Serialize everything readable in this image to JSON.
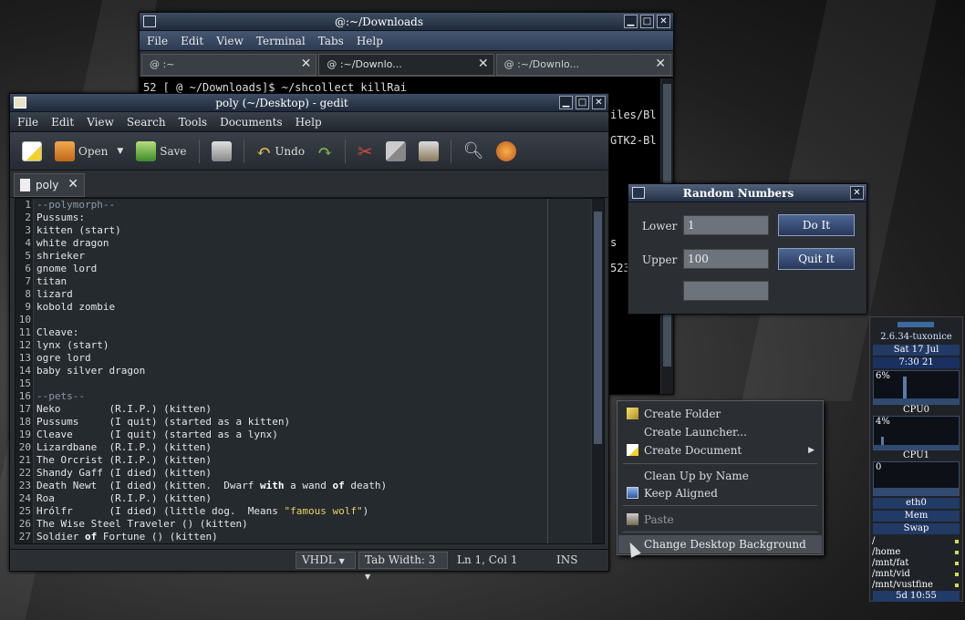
{
  "terminal": {
    "title": "@:~/Downloads",
    "menu": [
      "File",
      "Edit",
      "View",
      "Terminal",
      "Tabs",
      "Help"
    ],
    "tabs": [
      "@ :~",
      "@ :~/Downlo...",
      "@ :~/Downlo..."
    ],
    "prompt_line": "52 [ @ ~/Downloads]$ ~/shcollect killRai",
    "fragments": [
      "iles/Bl",
      "GTK2-Bl",
      "s",
      "523"
    ]
  },
  "gedit": {
    "title": "poly (~/Desktop) - gedit",
    "menu": [
      "File",
      "Edit",
      "View",
      "Search",
      "Tools",
      "Documents",
      "Help"
    ],
    "toolbar": {
      "open_label": "Open",
      "save_label": "Save",
      "undo_label": "Undo"
    },
    "tab_label": "poly",
    "lines": [
      {
        "n": "1",
        "text": "--polymorph--",
        "cls": "comment"
      },
      {
        "n": "2",
        "text": "Pussums:"
      },
      {
        "n": "3",
        "text": "kitten (start)"
      },
      {
        "n": "4",
        "text": "white dragon"
      },
      {
        "n": "5",
        "text": "shrieker"
      },
      {
        "n": "6",
        "text": "gnome lord"
      },
      {
        "n": "7",
        "text": "titan"
      },
      {
        "n": "8",
        "text": "lizard"
      },
      {
        "n": "9",
        "text": "kobold zombie"
      },
      {
        "n": "10",
        "text": ""
      },
      {
        "n": "11",
        "text": "Cleave:"
      },
      {
        "n": "12",
        "text": "lynx (start)"
      },
      {
        "n": "13",
        "text": "ogre lord"
      },
      {
        "n": "14",
        "text": "baby silver dragon"
      },
      {
        "n": "15",
        "text": ""
      },
      {
        "n": "16",
        "text": "--pets--",
        "cls": "comment"
      },
      {
        "n": "17",
        "text": "Neko        (R.I.P.) (kitten)"
      },
      {
        "n": "18",
        "text": "Pussums     (I quit) (started as a kitten)"
      },
      {
        "n": "19",
        "text": "Cleave      (I quit) (started as a lynx)"
      },
      {
        "n": "20",
        "text": "Lizardbane  (R.I.P.) (kitten)"
      },
      {
        "n": "21",
        "text": "The Orcrist (R.I.P.) (kitten)"
      },
      {
        "n": "22",
        "text": "Shandy Gaff (I died) (kitten)"
      },
      {
        "n": "23",
        "pre": "Death Newt  (I died) (kitten.  Dwarf ",
        "kw1": "with",
        "mid": " a wand ",
        "kw2": "of",
        "post": " death)"
      },
      {
        "n": "24",
        "text": "Roa         (R.I.P.) (kitten)"
      },
      {
        "n": "25",
        "pre": "Hrólfr      (I died) (little dog.  Means ",
        "str": "\"famous wolf\"",
        "post": ")"
      },
      {
        "n": "26",
        "text": "The Wise Steel Traveler () (kitten)"
      },
      {
        "n": "27",
        "pre": "Soldier ",
        "kw1": "of",
        "post": " Fortune () (kitten)"
      }
    ],
    "status": {
      "language": "VHDL",
      "tab_width": "Tab Width:  3",
      "position": "Ln 1, Col 1",
      "mode": "INS"
    }
  },
  "random": {
    "title": "Random Numbers",
    "lower_label": "Lower",
    "lower_value": "1",
    "upper_label": "Upper",
    "upper_value": "100",
    "result_value": "",
    "doit_label": "Do It",
    "quit_label": "Quit It"
  },
  "context_menu": {
    "items": [
      "Create Folder",
      "Create Launcher...",
      "Create Document",
      "Clean Up by Name",
      "Keep Aligned",
      "Paste",
      "Change Desktop Background"
    ]
  },
  "conky": {
    "kernel": "2.6.34-tuxonice",
    "date": "Sat 17 Jul",
    "time": "7:30 21",
    "cpu0_pct": "6%",
    "cpu0_label": "CPU0",
    "cpu1_pct": "4%",
    "cpu1_label": "CPU1",
    "net_value": "0",
    "net_label": "eth0",
    "mem_label": "Mem",
    "swap_label": "Swap",
    "fs": [
      "/",
      "/home",
      "/mnt/fat",
      "/mnt/vid",
      "/mnt/vustfine"
    ],
    "uptime": "5d 10:55"
  }
}
